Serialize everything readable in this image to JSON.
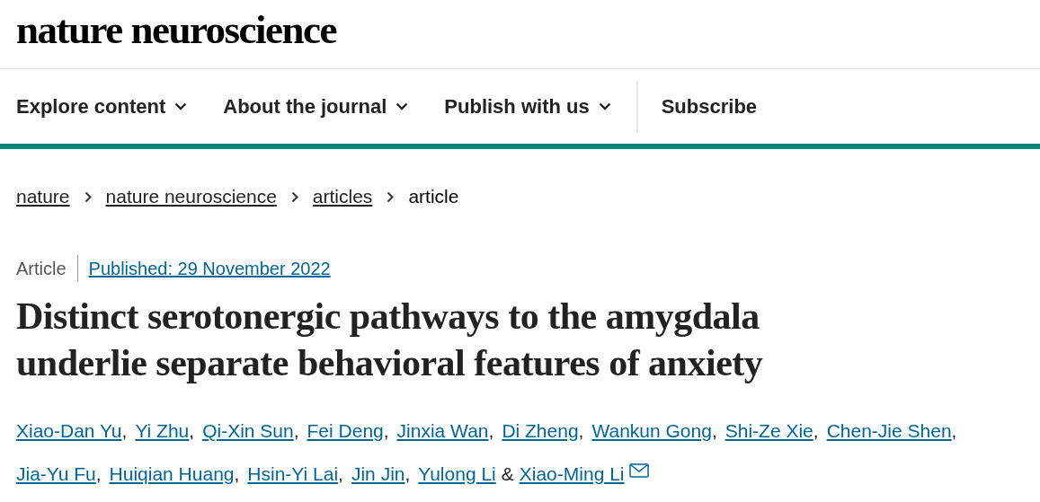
{
  "logo": "nature neuroscience",
  "nav": [
    {
      "label": "Explore content",
      "kind": "dropdown"
    },
    {
      "label": "About the journal",
      "kind": "dropdown"
    },
    {
      "label": "Publish with us",
      "kind": "dropdown"
    },
    {
      "label": "Subscribe",
      "kind": "link"
    }
  ],
  "breadcrumbs": [
    {
      "label": "nature",
      "kind": "link"
    },
    {
      "label": "nature neuroscience",
      "kind": "link"
    },
    {
      "label": "articles",
      "kind": "link"
    },
    {
      "label": "article",
      "kind": "current"
    }
  ],
  "article_type": "Article",
  "published": "Published: 29 November 2022",
  "title": "Distinct serotonergic pathways to the amygdala underlie separate behavioral features of anxiety",
  "author_lines": [
    [
      {
        "name": "Xiao-Dan Yu",
        "separator": ",",
        "email": false
      },
      {
        "name": "Yi Zhu",
        "separator": ",",
        "email": false
      },
      {
        "name": "Qi-Xin Sun",
        "separator": ",",
        "email": false
      },
      {
        "name": "Fei Deng",
        "separator": ",",
        "email": false
      },
      {
        "name": "Jinxia Wan",
        "separator": ",",
        "email": false
      },
      {
        "name": "Di Zheng",
        "separator": ",",
        "email": false
      },
      {
        "name": "Wankun Gong",
        "separator": ",",
        "email": false
      },
      {
        "name": "Shi-Ze Xie",
        "separator": ",",
        "email": false
      },
      {
        "name": "Chen-Jie Shen",
        "separator": ",",
        "email": false
      }
    ],
    [
      {
        "name": "Jia-Yu Fu",
        "separator": ",",
        "email": false
      },
      {
        "name": "Huiqian Huang",
        "separator": ",",
        "email": false
      },
      {
        "name": "Hsin-Yi Lai",
        "separator": ",",
        "email": false
      },
      {
        "name": "Jin Jin",
        "separator": ",",
        "email": false
      },
      {
        "name": "Yulong Li",
        "separator": "&",
        "email": false
      },
      {
        "name": "Xiao-Ming Li",
        "email": true
      }
    ]
  ]
}
